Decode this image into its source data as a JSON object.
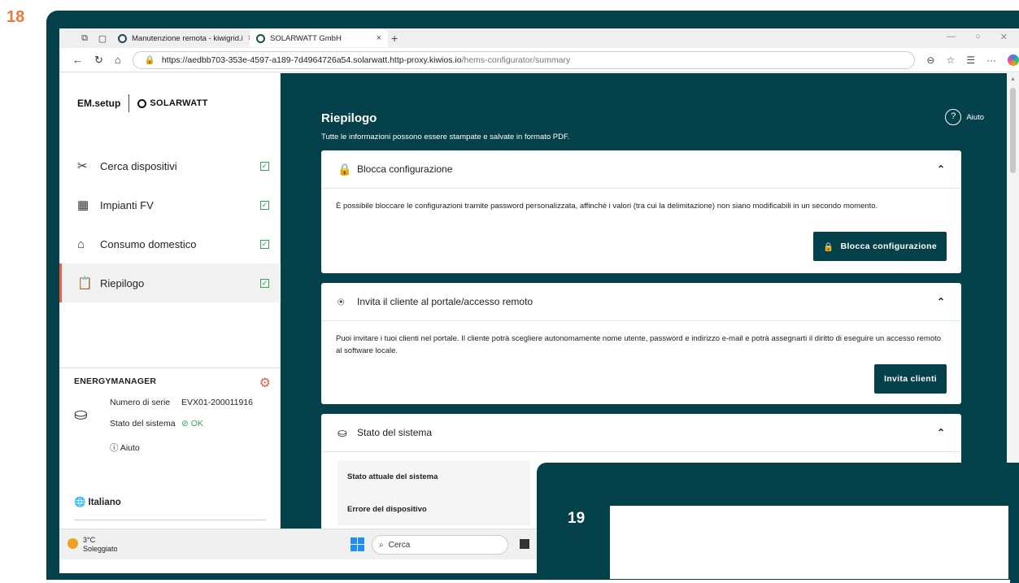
{
  "step_number": "18",
  "overlay_step_number": "19",
  "browser": {
    "tabs": [
      {
        "label": "Manutenzione remota - kiwigrid.i"
      },
      {
        "label": "SOLARWATT GmbH"
      }
    ],
    "url_main": "https://aedbb703-353e-4597-a189-7d4964726a54.solarwatt.http-proxy.kiwios.io",
    "url_path": "/hems-configurator/summary"
  },
  "sidebar": {
    "app_name": "EM.setup",
    "logo_text": "SOLARWATT",
    "items": [
      {
        "label": "Cerca dispositivi",
        "icon": "tools-icon"
      },
      {
        "label": "Impianti FV",
        "icon": "solar-panel-icon"
      },
      {
        "label": "Consumo domestico",
        "icon": "house-icon"
      },
      {
        "label": "Riepilogo",
        "icon": "clipboard-icon"
      }
    ],
    "energymanager": {
      "title": "ENERGYMANAGER",
      "serial_label": "Numero di serie",
      "serial_value": "EVX01-200011916",
      "status_label": "Stato del sistema",
      "status_value": "OK",
      "help": "Aiuto"
    },
    "language": "Italiano"
  },
  "main": {
    "title": "Riepilogo",
    "subtitle": "Tutte le informazioni possono essere stampate e salvate in formato PDF.",
    "help": "Aiuto",
    "lock_card": {
      "title": "Blocca configurazione",
      "body": "È possibile bloccare le configurazioni tramite password personalizzata, affinché i valori (tra cui la delimitazione) non siano modificabili in un secondo momento.",
      "button": "Blocca configurazione"
    },
    "invite_card": {
      "title": "Invita il cliente al portale/accesso remoto",
      "body": "Puoi invitare i tuoi clienti nel portale. Il cliente potrà scegliere autonomamente nome utente, password e indirizzo e-mail e potrà assegnarti il diritto di eseguire un accesso remoto al software locale.",
      "button": "Invita clienti"
    },
    "status_card": {
      "title": "Stato del sistema",
      "rows": [
        "Stato attuale del sistema",
        "Errore del dispositivo"
      ]
    }
  },
  "taskbar": {
    "temp": "3°C",
    "weather": "Soleggiato",
    "search": "Cerca"
  }
}
